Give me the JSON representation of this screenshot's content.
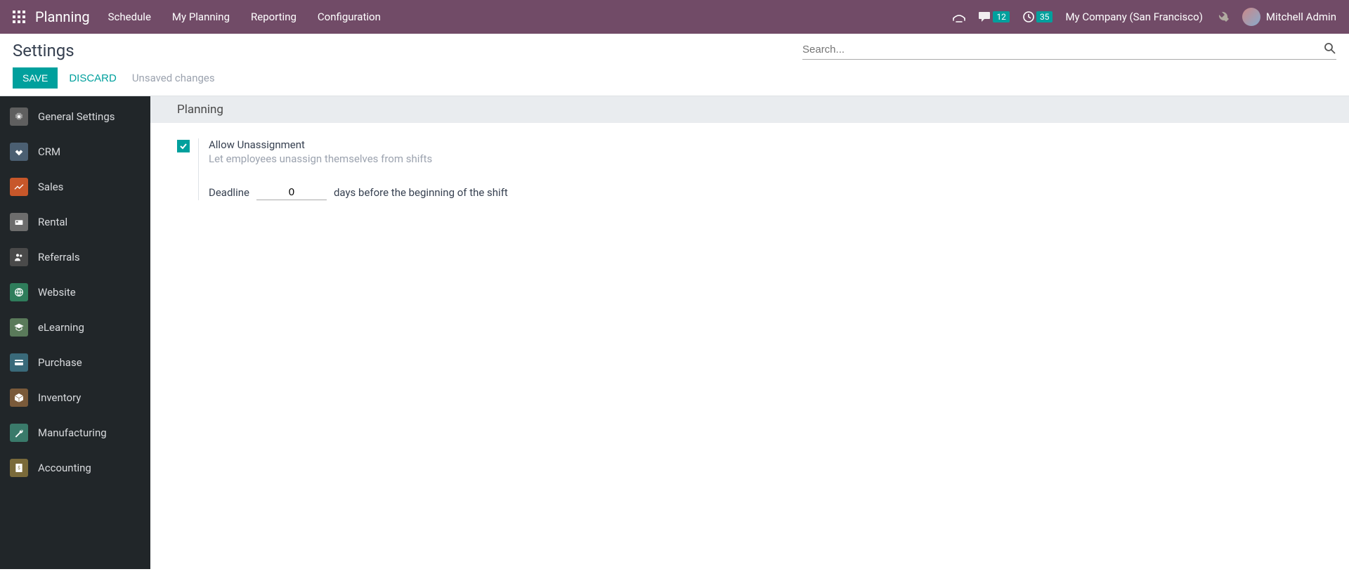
{
  "nav": {
    "brand": "Planning",
    "menu": [
      "Schedule",
      "My Planning",
      "Reporting",
      "Configuration"
    ],
    "messaging_badge": "12",
    "activities_badge": "35",
    "company": "My Company (San Francisco)",
    "user": "Mitchell Admin"
  },
  "control": {
    "title": "Settings",
    "search_placeholder": "Search...",
    "save_label": "SAVE",
    "discard_label": "DISCARD",
    "status": "Unsaved changes"
  },
  "sidebar": {
    "items": [
      {
        "label": "General Settings"
      },
      {
        "label": "CRM"
      },
      {
        "label": "Sales"
      },
      {
        "label": "Rental"
      },
      {
        "label": "Referrals"
      },
      {
        "label": "Website"
      },
      {
        "label": "eLearning"
      },
      {
        "label": "Purchase"
      },
      {
        "label": "Inventory"
      },
      {
        "label": "Manufacturing"
      },
      {
        "label": "Accounting"
      }
    ]
  },
  "section": {
    "header": "Planning",
    "allow_unassignment": {
      "checked": true,
      "label": "Allow Unassignment",
      "desc": "Let employees unassign themselves from shifts",
      "deadline_label": "Deadline",
      "deadline_value": "0",
      "deadline_suffix": "days before the beginning of the shift"
    }
  }
}
